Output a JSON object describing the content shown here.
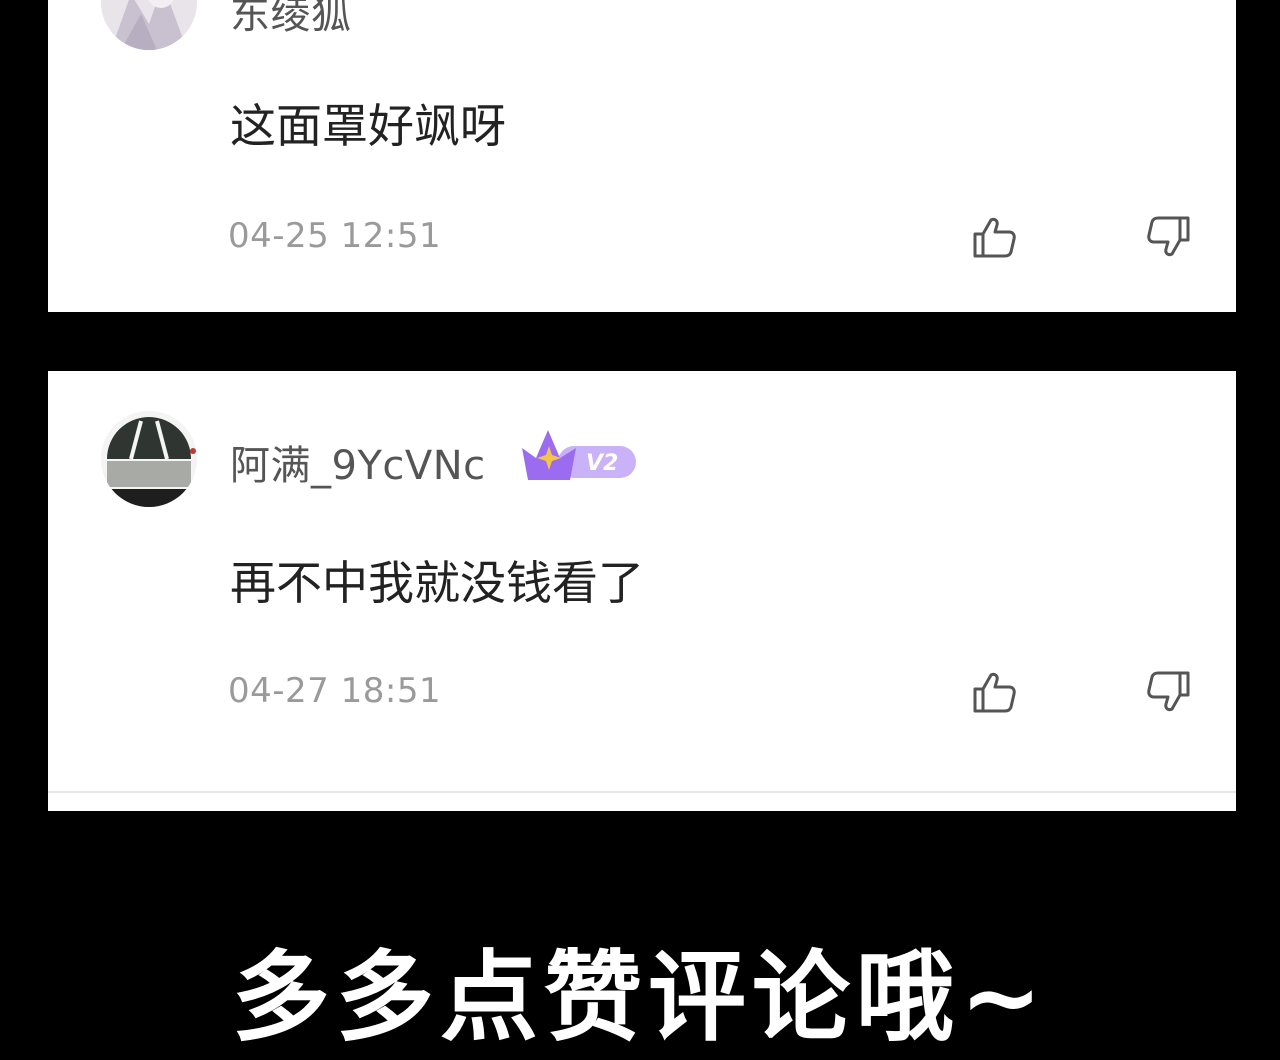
{
  "comments": [
    {
      "username": "东绫狐",
      "text": "这面罩好飒呀",
      "time": "04-25 12:51"
    },
    {
      "username": "阿满_9YcVNc",
      "badge": "V2",
      "text": "再不中我就没钱看了",
      "time": "04-27 18:51"
    }
  ],
  "footer": {
    "text": "多多点赞评论哦~"
  },
  "colors": {
    "badge_purple": "#9b6cf0",
    "star_gold": "#f3c64a"
  },
  "icons": {
    "like": "thumbs-up-icon",
    "dislike": "thumbs-down-icon"
  }
}
